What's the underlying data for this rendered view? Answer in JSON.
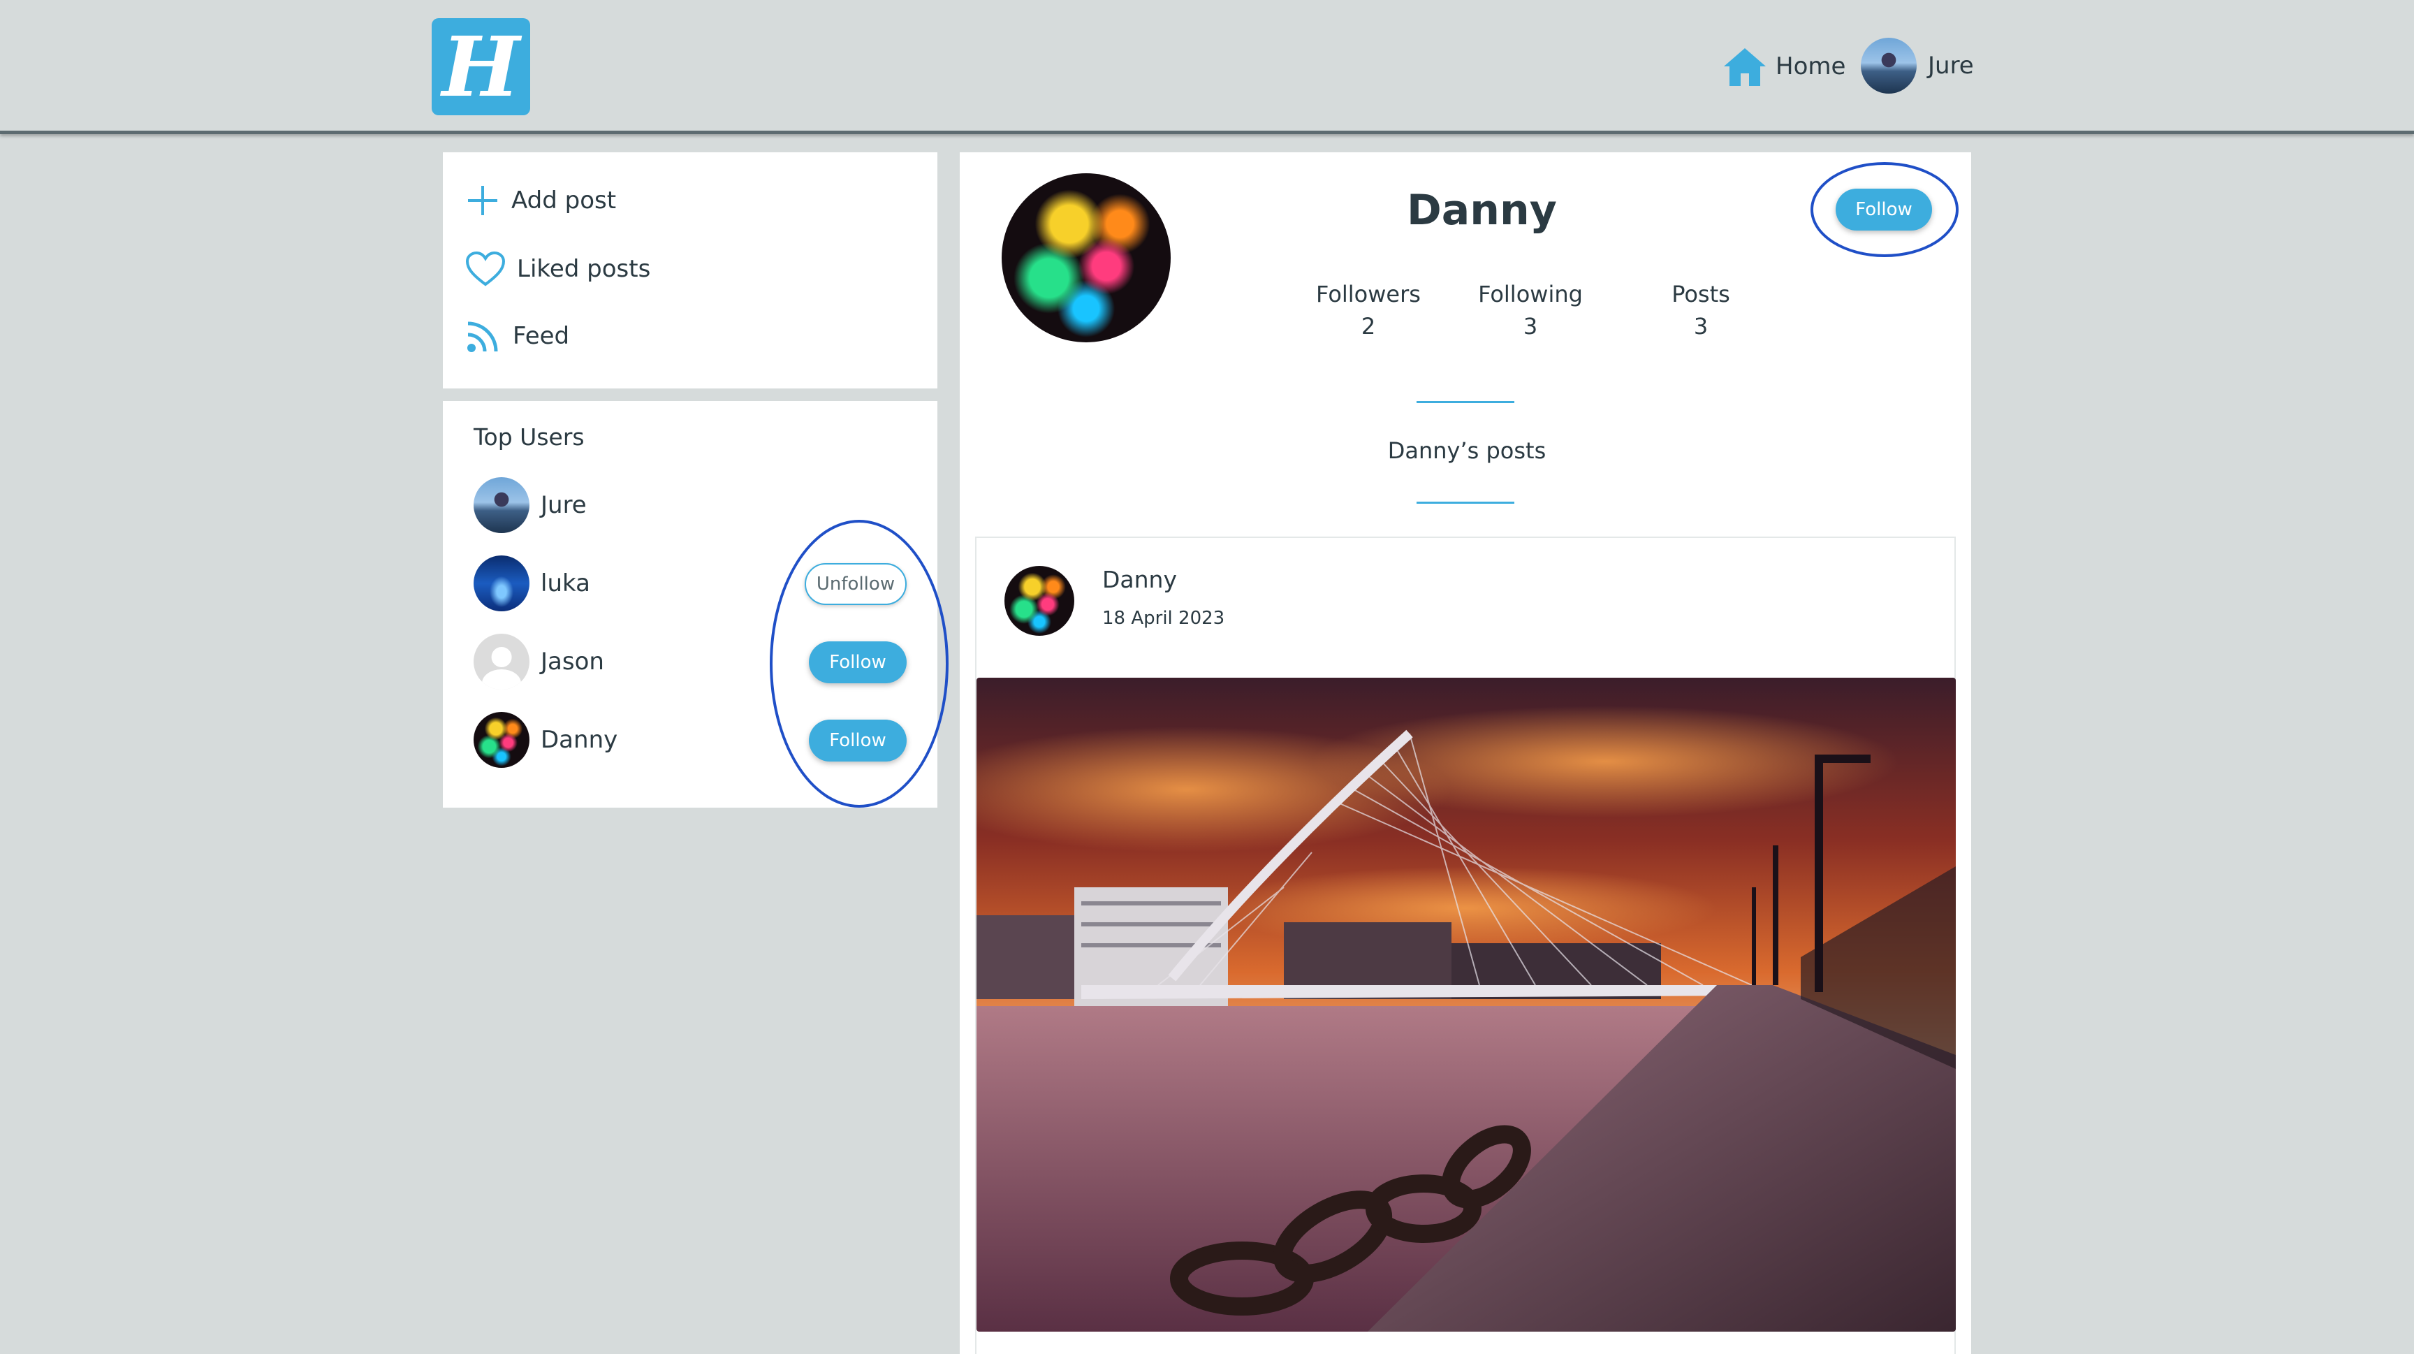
{
  "header": {
    "logo_letter": "H",
    "home_label": "Home",
    "user_label": "Jure"
  },
  "menu": {
    "items": [
      {
        "label": "Add post",
        "icon": "plus-icon"
      },
      {
        "label": "Liked posts",
        "icon": "heart-icon"
      },
      {
        "label": "Feed",
        "icon": "rss-icon"
      }
    ]
  },
  "top_users": {
    "title": "Top Users",
    "users": [
      {
        "name": "Jure",
        "button": ""
      },
      {
        "name": "luka",
        "button": "Unfollow"
      },
      {
        "name": "Jason",
        "button": "Follow"
      },
      {
        "name": "Danny",
        "button": "Follow"
      }
    ]
  },
  "profile": {
    "name": "Danny",
    "follow_label": "Follow",
    "stats": [
      {
        "label": "Followers",
        "value": "2"
      },
      {
        "label": "Following",
        "value": "3"
      },
      {
        "label": "Posts",
        "value": "3"
      }
    ],
    "posts_title": "Danny’s posts"
  },
  "post": {
    "author": "Danny",
    "date": "18 April 2023"
  },
  "colors": {
    "accent": "#3dadde",
    "background": "#d6dbdb",
    "text": "#2b3a42",
    "annotation": "#1f4fc7"
  }
}
